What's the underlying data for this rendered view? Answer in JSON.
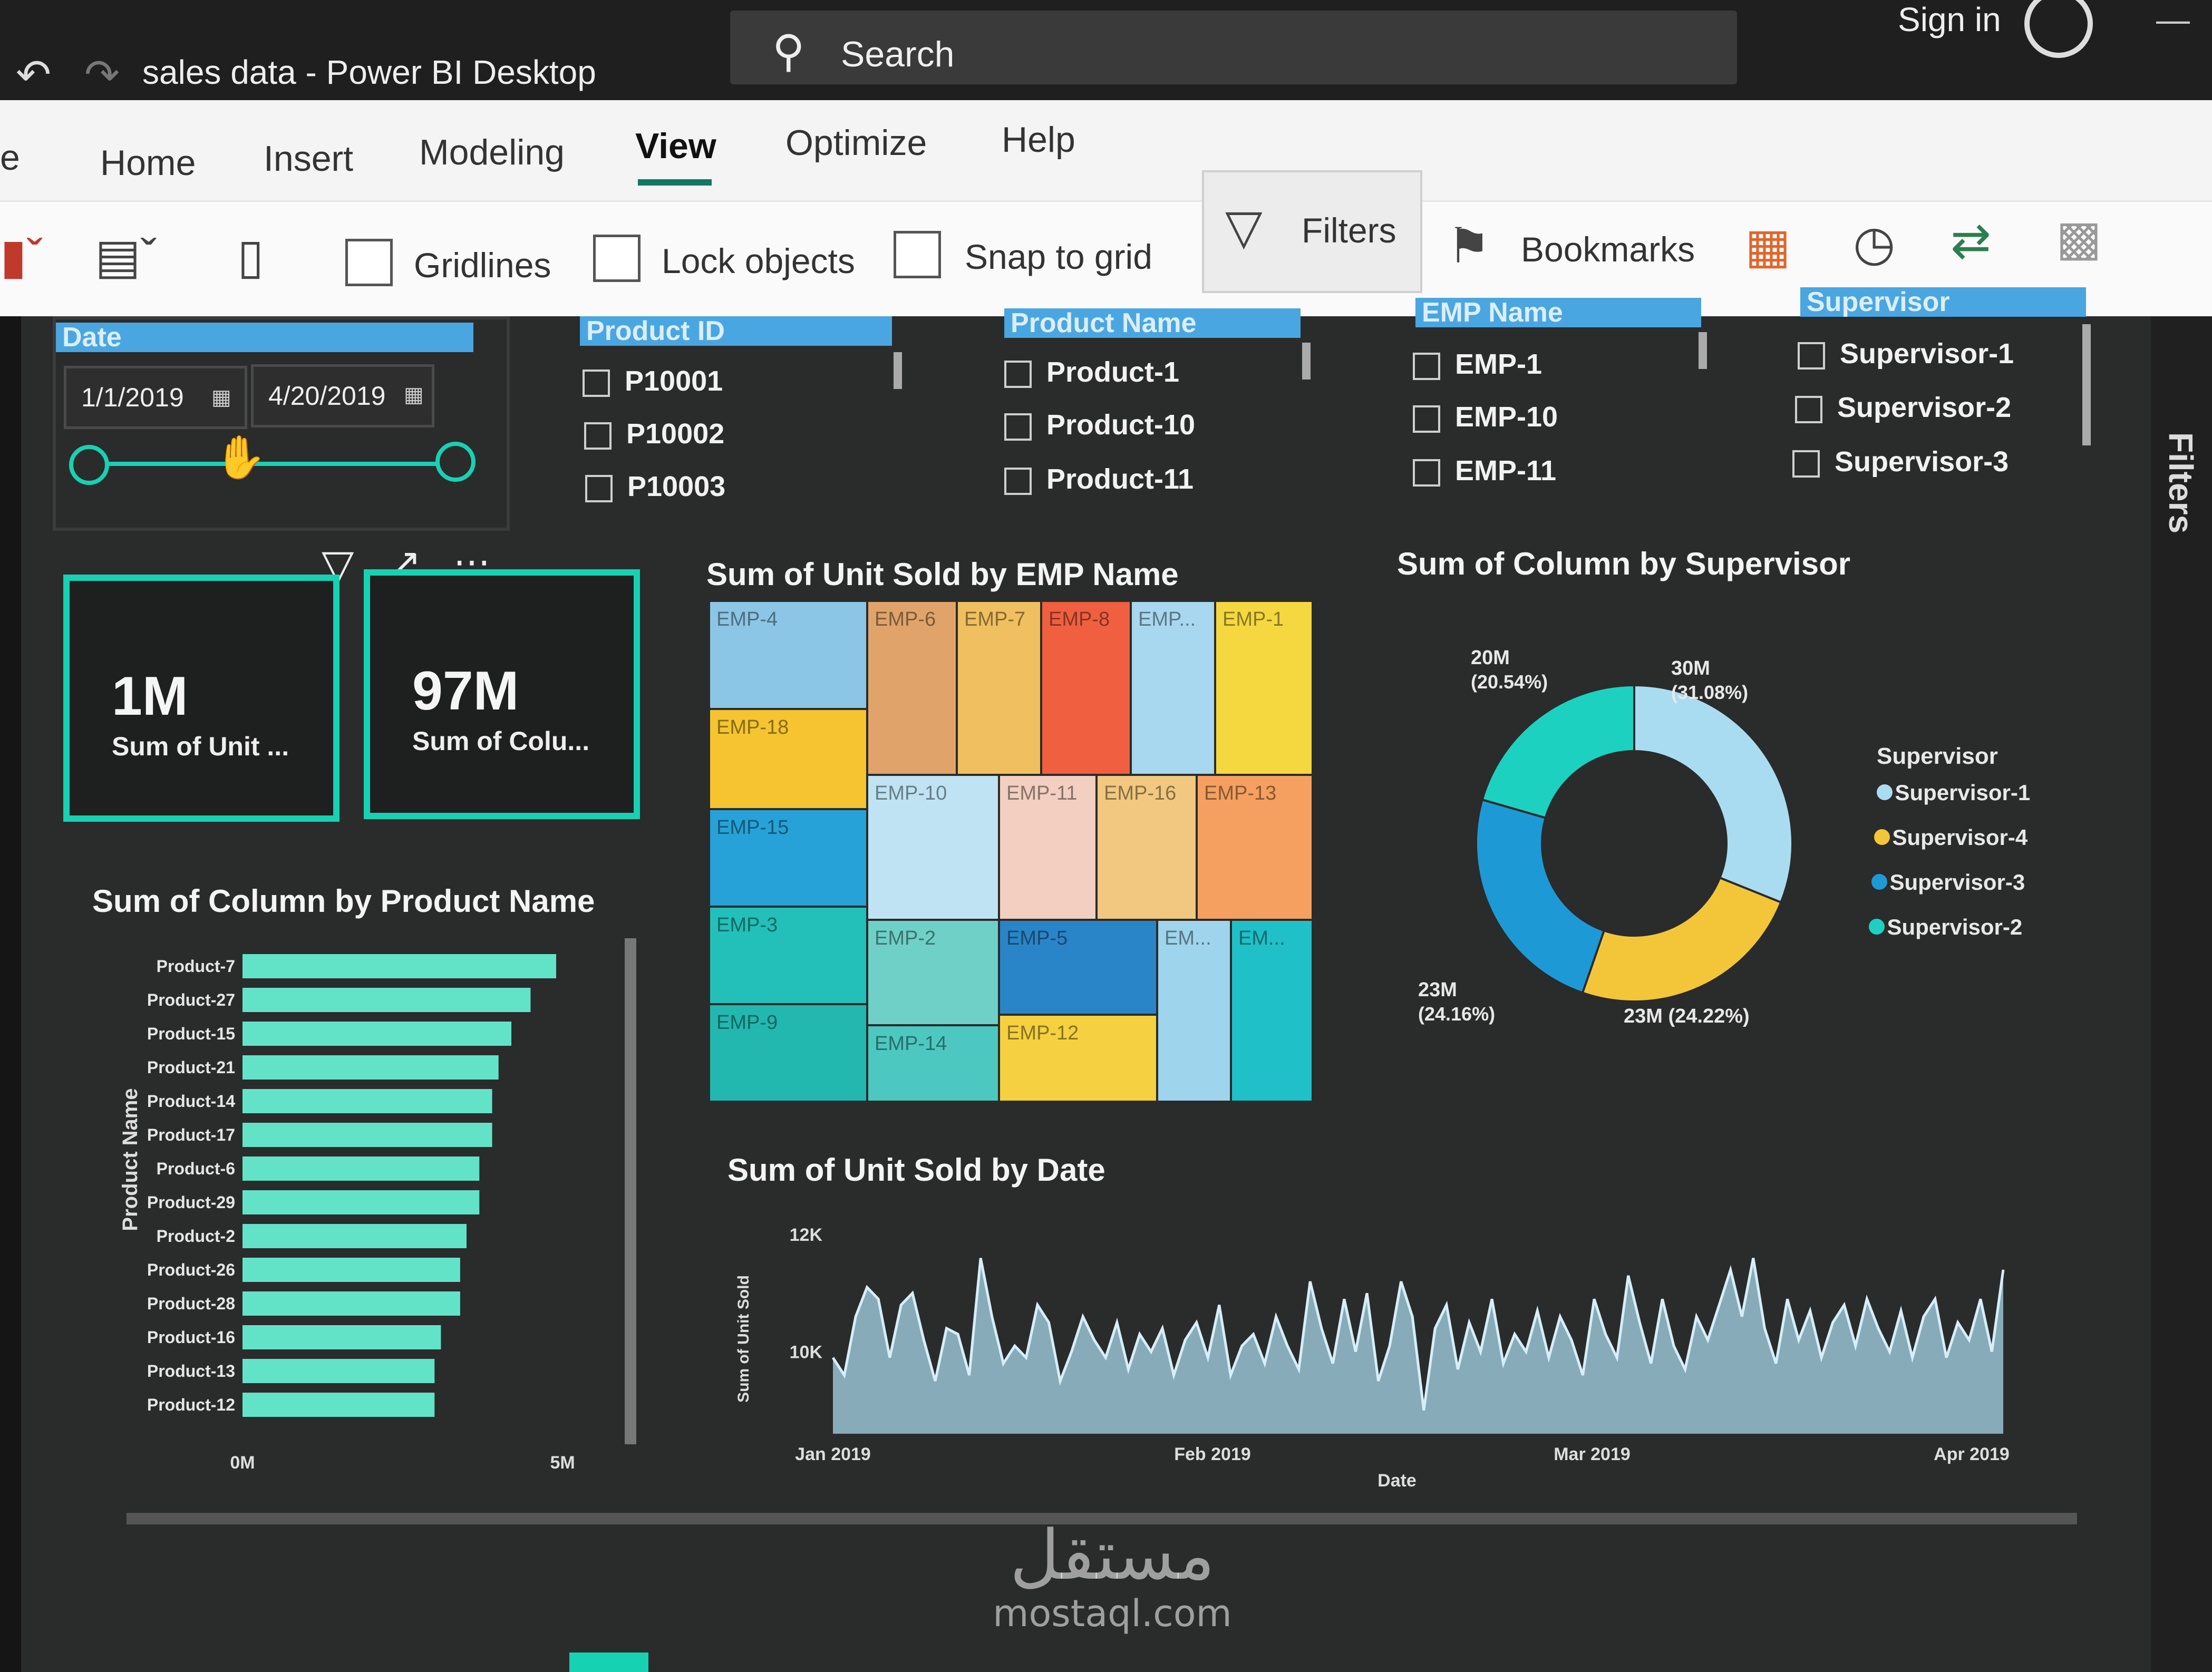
{
  "window": {
    "title": "sales data - Power BI Desktop",
    "sign_in": "Sign in"
  },
  "search": {
    "label": "Search"
  },
  "menu": {
    "tabs": [
      {
        "label": "e"
      },
      {
        "label": "Home"
      },
      {
        "label": "Insert"
      },
      {
        "label": "Modeling"
      },
      {
        "label": "View",
        "active": true
      },
      {
        "label": "Optimize"
      },
      {
        "label": "Help"
      }
    ]
  },
  "ribbon": {
    "gridlines": "Gridlines",
    "lock_objects": "Lock objects",
    "snap_to_grid": "Snap to grid",
    "filters": "Filters",
    "bookmarks": "Bookmarks"
  },
  "filters_pane": {
    "label": "Filters"
  },
  "date_slicer": {
    "header": "Date",
    "start": "1/1/2019",
    "end": "4/20/2019"
  },
  "slicers": [
    {
      "header": "Product ID",
      "items": [
        "P10001",
        "P10002",
        "P10003"
      ]
    },
    {
      "header": "Product Name",
      "items": [
        "Product-1",
        "Product-10",
        "Product-11"
      ]
    },
    {
      "header": "EMP Name",
      "items": [
        "EMP-1",
        "EMP-10",
        "EMP-11"
      ]
    },
    {
      "header": "Supervisor",
      "items": [
        "Supervisor-1",
        "Supervisor-2",
        "Supervisor-3"
      ]
    }
  ],
  "cards": [
    {
      "value": "1M",
      "label": "Sum of Unit ..."
    },
    {
      "value": "97M",
      "label": "Sum of Colu..."
    }
  ],
  "treemap": {
    "title": "Sum of Unit Sold by EMP Name",
    "tiles": [
      {
        "label": "EMP-4",
        "color": "#8cc6e6"
      },
      {
        "label": "EMP-6",
        "color": "#e0a46a"
      },
      {
        "label": "EMP-7",
        "color": "#f0c060"
      },
      {
        "label": "EMP-8",
        "color": "#f06040"
      },
      {
        "label": "EMP...",
        "color": "#a8d8f0"
      },
      {
        "label": "EMP-1",
        "color": "#f5d840"
      },
      {
        "label": "EMP-18",
        "color": "#f5c430"
      },
      {
        "label": "EMP-10",
        "color": "#bfe3f2"
      },
      {
        "label": "EMP-11",
        "color": "#f2cfc0"
      },
      {
        "label": "EMP-16",
        "color": "#f2c880"
      },
      {
        "label": "EMP-13",
        "color": "#f5a060"
      },
      {
        "label": "EMP-15",
        "color": "#27a2d8"
      },
      {
        "label": "EMP-2",
        "color": "#6fd0c8"
      },
      {
        "label": "EMP-5",
        "color": "#2a85c8"
      },
      {
        "label": "EM...",
        "color": "#9ed4ec"
      },
      {
        "label": "EM...",
        "color": "#1fc0c8"
      },
      {
        "label": "EMP-3",
        "color": "#22c0b8"
      },
      {
        "label": "EMP-9",
        "color": "#22b8b0"
      },
      {
        "label": "EMP-14",
        "color": "#4cc8c0"
      },
      {
        "label": "EMP-12",
        "color": "#f5d040"
      }
    ]
  },
  "donut": {
    "title": "Sum of Column by Supervisor",
    "legend_title": "Supervisor",
    "slices": [
      {
        "name": "Supervisor-1",
        "value": 30,
        "pct": 31.08,
        "label": "30M",
        "pct_label": "(31.08%)",
        "color": "#a9dcf0"
      },
      {
        "name": "Supervisor-4",
        "value": 23,
        "pct": 24.22,
        "label": "23M (24.22%)",
        "pct_label": "",
        "color": "#f3c63a"
      },
      {
        "name": "Supervisor-3",
        "value": 23,
        "pct": 24.16,
        "label": "23M",
        "pct_label": "(24.16%)",
        "color": "#1d9ad6"
      },
      {
        "name": "Supervisor-2",
        "value": 20,
        "pct": 20.54,
        "label": "20M",
        "pct_label": "(20.54%)",
        "color": "#1dd1c1"
      }
    ]
  },
  "chart_data": [
    {
      "type": "bar",
      "title": "Sum of Column by Product Name",
      "ylabel": "Product Name",
      "xticks": [
        "0M",
        "5M"
      ],
      "xlim": [
        0,
        5.6
      ],
      "categories": [
        "Product-7",
        "Product-27",
        "Product-15",
        "Product-21",
        "Product-14",
        "Product-17",
        "Product-6",
        "Product-29",
        "Product-2",
        "Product-26",
        "Product-28",
        "Product-16",
        "Product-13",
        "Product-12"
      ],
      "values": [
        4.9,
        4.5,
        4.2,
        4.0,
        3.9,
        3.9,
        3.7,
        3.7,
        3.5,
        3.4,
        3.4,
        3.1,
        3.0,
        3.0
      ],
      "color": "#62e3c8"
    },
    {
      "type": "area",
      "title": "Sum of Unit Sold by Date",
      "xlabel": "Date",
      "ylabel": "Sum of Unit Sold",
      "yticks": [
        "12K",
        "10K"
      ],
      "ylim": [
        8.6,
        12.2
      ],
      "xticks": [
        "Jan 2019",
        "Feb 2019",
        "Mar 2019",
        "Apr 2019"
      ],
      "color": "#a8d7ea",
      "values": [
        9.9,
        9.6,
        10.6,
        11.1,
        10.9,
        9.9,
        10.8,
        11.0,
        10.2,
        9.5,
        10.4,
        10.3,
        9.6,
        11.6,
        10.6,
        9.8,
        10.1,
        9.9,
        10.8,
        10.5,
        9.5,
        10.0,
        10.6,
        10.2,
        9.9,
        10.5,
        9.7,
        10.3,
        10.0,
        10.4,
        9.6,
        10.2,
        10.5,
        9.9,
        10.8,
        9.6,
        10.1,
        10.3,
        9.8,
        10.6,
        10.1,
        9.7,
        11.2,
        10.4,
        9.8,
        10.9,
        10.0,
        11.0,
        9.5,
        10.1,
        11.2,
        10.6,
        9.0,
        10.4,
        10.8,
        9.7,
        10.5,
        10.0,
        10.9,
        9.8,
        10.3,
        10.0,
        10.7,
        9.9,
        10.6,
        10.2,
        9.6,
        10.9,
        10.3,
        9.9,
        11.3,
        10.5,
        9.8,
        10.9,
        10.1,
        9.7,
        10.6,
        10.2,
        10.8,
        11.4,
        10.6,
        11.6,
        10.4,
        9.8,
        10.9,
        10.2,
        10.7,
        9.9,
        10.5,
        10.8,
        10.1,
        10.9,
        10.4,
        10.0,
        10.7,
        9.9,
        10.6,
        10.9,
        9.9,
        10.5,
        10.2,
        10.9,
        10.0,
        11.4
      ]
    }
  ],
  "watermark": {
    "brand": "مستقل",
    "domain": "mostaql.com"
  }
}
